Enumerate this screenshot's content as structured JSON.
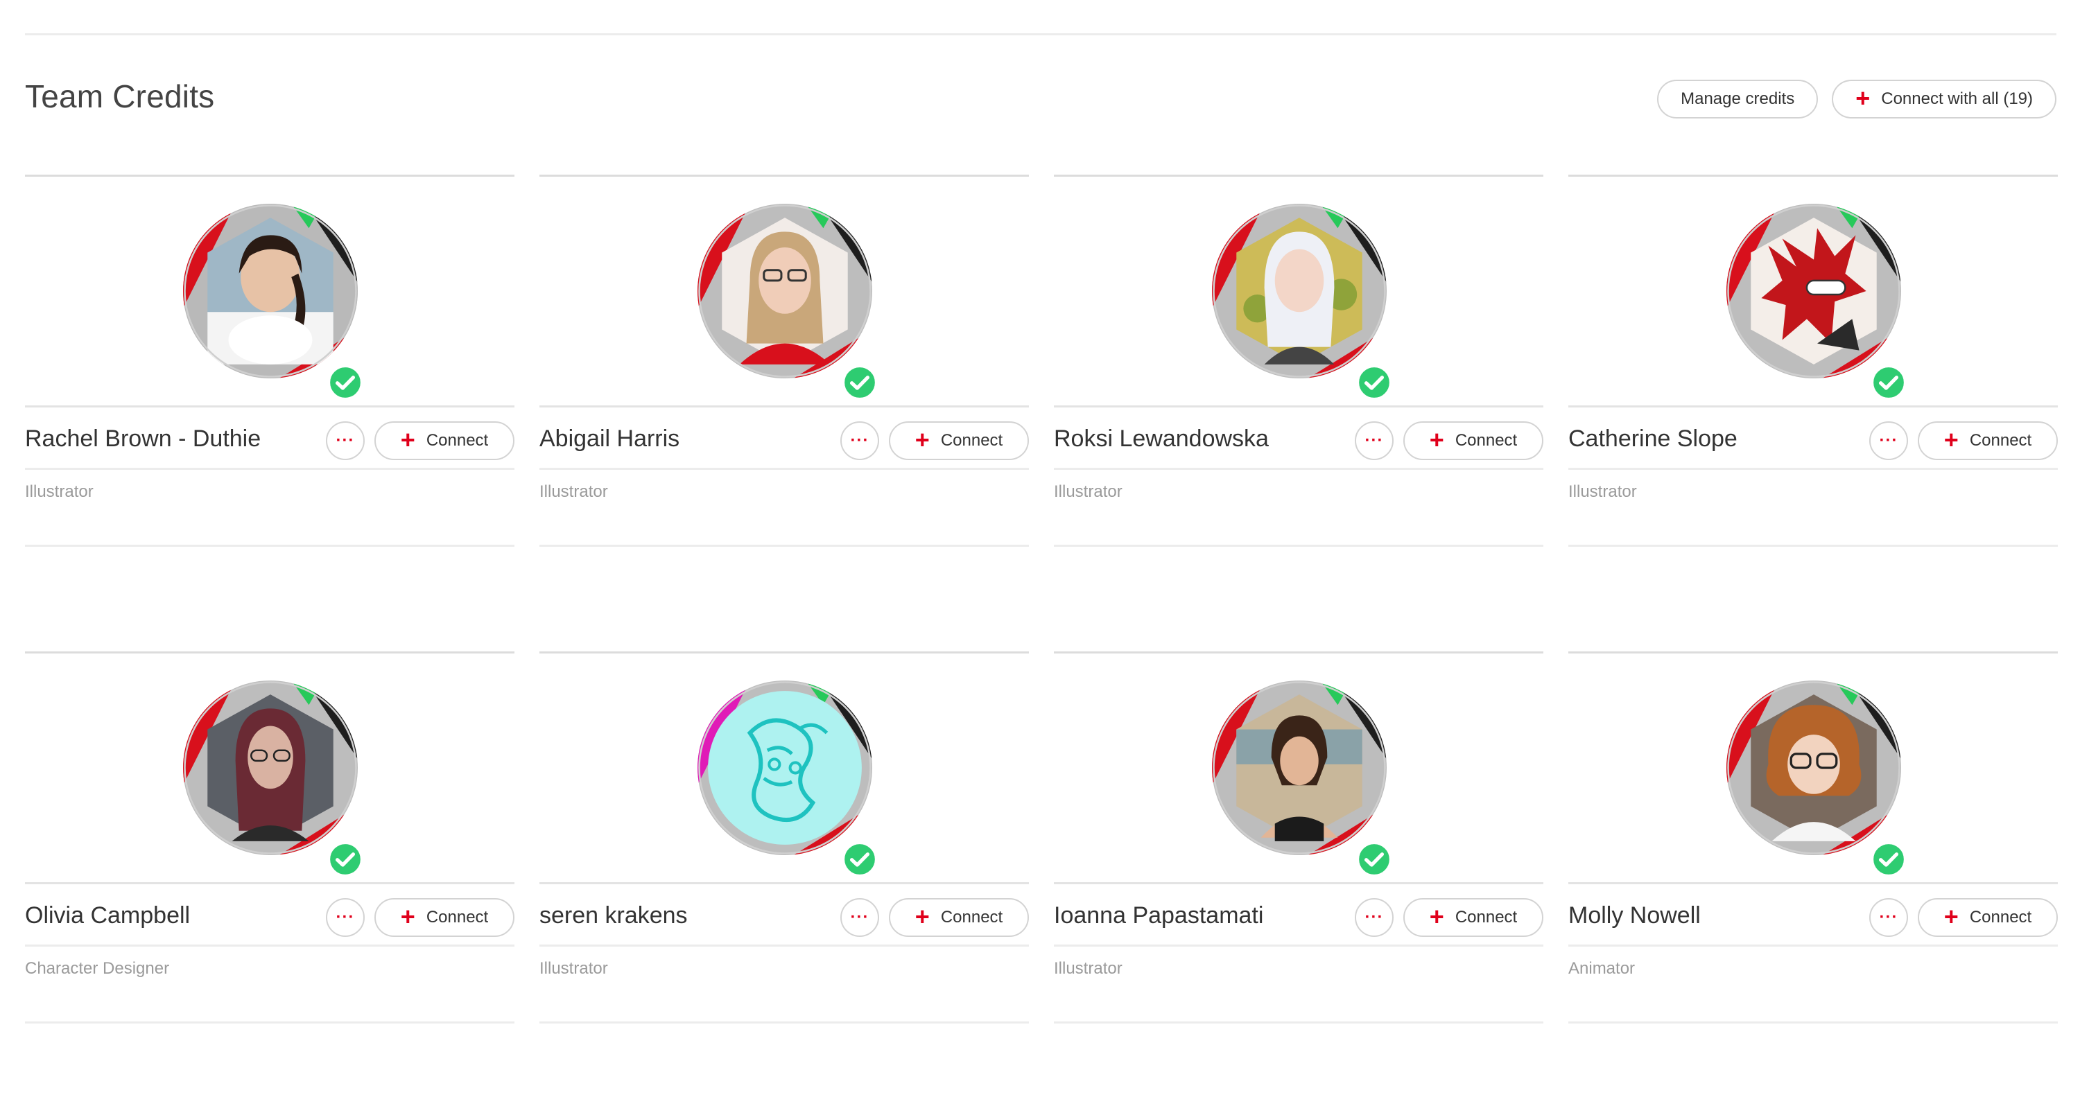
{
  "header": {
    "title": "Team Credits",
    "manage_label": "Manage credits",
    "connect_all_label": "Connect with all (19)"
  },
  "colors": {
    "accent": "#e0001b",
    "verified": "#2ecc71",
    "border": "#d3d3d3"
  },
  "card_actions": {
    "more_label": "···",
    "connect_label": "Connect"
  },
  "icons": {
    "plus": "plus-icon",
    "more": "more-icon",
    "verified": "check-badge-icon"
  },
  "members": [
    {
      "name": "Rachel Brown - Duthie",
      "role": "Illustrator"
    },
    {
      "name": "Abigail Harris",
      "role": "Illustrator"
    },
    {
      "name": "Roksi Lewandowska",
      "role": "Illustrator"
    },
    {
      "name": "Catherine Slope",
      "role": "Illustrator"
    },
    {
      "name": "Olivia Campbell",
      "role": "Character Designer"
    },
    {
      "name": "seren krakens",
      "role": "Illustrator"
    },
    {
      "name": "Ioanna Papastamati",
      "role": "Illustrator"
    },
    {
      "name": "Molly Nowell",
      "role": "Animator"
    }
  ]
}
